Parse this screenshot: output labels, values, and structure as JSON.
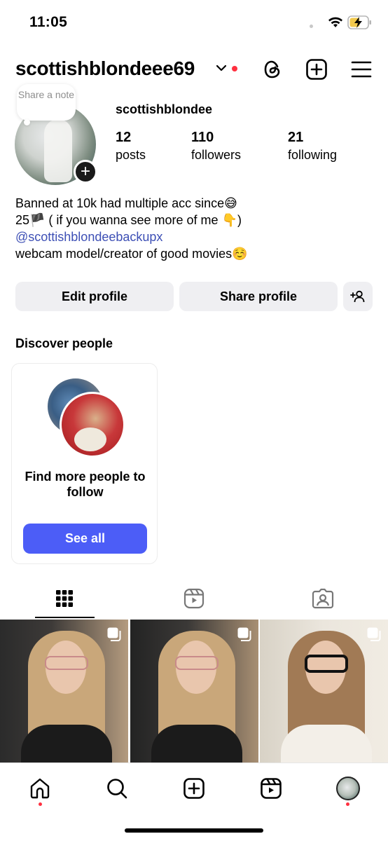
{
  "status_bar": {
    "time": "11:05"
  },
  "header": {
    "username": "scottishblondeee69"
  },
  "profile": {
    "note_placeholder": "Share a note",
    "display_name": "scottishblondee",
    "stats": [
      {
        "value": "12",
        "label": "posts"
      },
      {
        "value": "110",
        "label": "followers"
      },
      {
        "value": "21",
        "label": "following"
      }
    ],
    "bio": {
      "line1": "Banned at 10k had multiple acc since😅",
      "line2": "25🏴 ( if you wanna see more of me 👇)",
      "link": "@scottishblondeebackupx",
      "line4": "webcam model/creator of good movies☺️"
    }
  },
  "actions": {
    "edit_profile": "Edit profile",
    "share_profile": "Share profile"
  },
  "discover": {
    "title": "Discover people",
    "card_text": "Find more people to follow",
    "button": "See all"
  },
  "tabs": [
    "grid-icon",
    "reels-icon",
    "tagged-icon"
  ],
  "colors": {
    "accent": "#4c5df7",
    "link": "#3d4fb5",
    "notification": "#ff3040",
    "button_bg": "#efeff2"
  },
  "bottom_nav": [
    "home-icon",
    "search-icon",
    "create-icon",
    "reels-icon",
    "profile-avatar"
  ]
}
